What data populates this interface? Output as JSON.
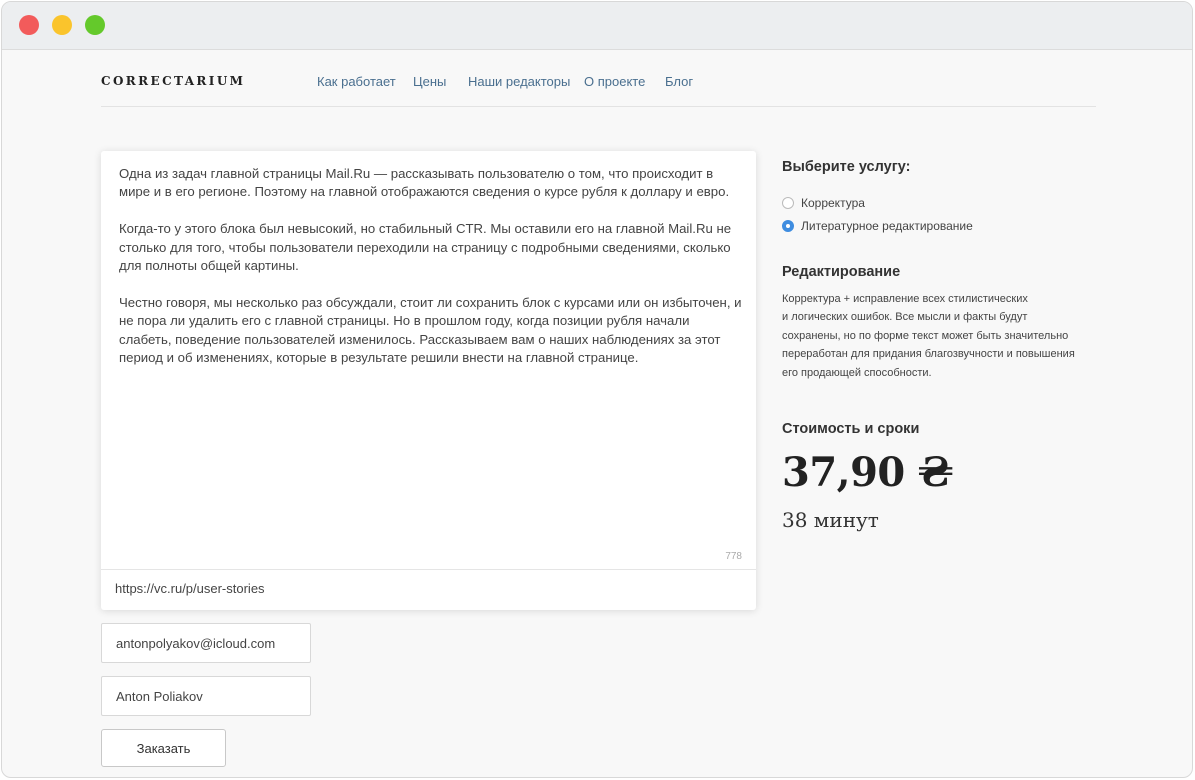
{
  "logo": "CORRECTARIUM",
  "nav": {
    "how_it_works": "Как работает",
    "prices": "Цены",
    "editors": "Наши редакторы",
    "about": "О проекте",
    "blog": "Блог"
  },
  "editor": {
    "paragraphs": [
      "Одна из задач главной страницы Mail.Ru — рассказывать пользователю о том, что происходит в мире и в его регионе. Поэтому на главной отображаются сведения о курсе рубля к доллару и евро.",
      "Когда-то у этого блока был невысокий, но стабильный CTR. Мы оставили его на главной Mail.Ru не столько для того, чтобы пользователи переходили на страницу с подробными сведениями, сколько для полноты общей картины.",
      "Честно говоря, мы несколько раз обсуждали, стоит ли сохранить блок с курсами или он избыточен, и не пора ли удалить его с главной страницы. Но в прошлом году, когда позиции рубля начали слабеть, поведение пользователей изменилось. Рассказываем вам о наших наблюдениях за этот период и об изменениях, которые в результате решили внести на главной странице."
    ],
    "char_count": "778",
    "url": "https://vc.ru/p/user-stories"
  },
  "form": {
    "email": "antonpolyakov@icloud.com",
    "name": "Anton Poliakov",
    "order_button": "Заказать"
  },
  "service": {
    "heading": "Выберите услугу:",
    "options": [
      {
        "label": "Корректура",
        "selected": false
      },
      {
        "label": "Литературное редактирование",
        "selected": true
      }
    ]
  },
  "editing": {
    "heading": "Редактирование",
    "description_lines": [
      "Корректура + исправление всех стилистических",
      "и логических ошибок. Все мысли и факты будут",
      "сохранены, но по форме текст может быть значительно",
      "переработан для придания благозвучности и повышения",
      "его продающей способности."
    ]
  },
  "cost": {
    "heading": "Стоимость и сроки",
    "price": "37,90 ₴",
    "time": "38 минут"
  },
  "colors": {
    "accent": "#3f8de0",
    "nav_link": "#4a6f8f",
    "close": "#f25b5b",
    "minimize": "#fac42c",
    "maximize": "#64c92b"
  }
}
